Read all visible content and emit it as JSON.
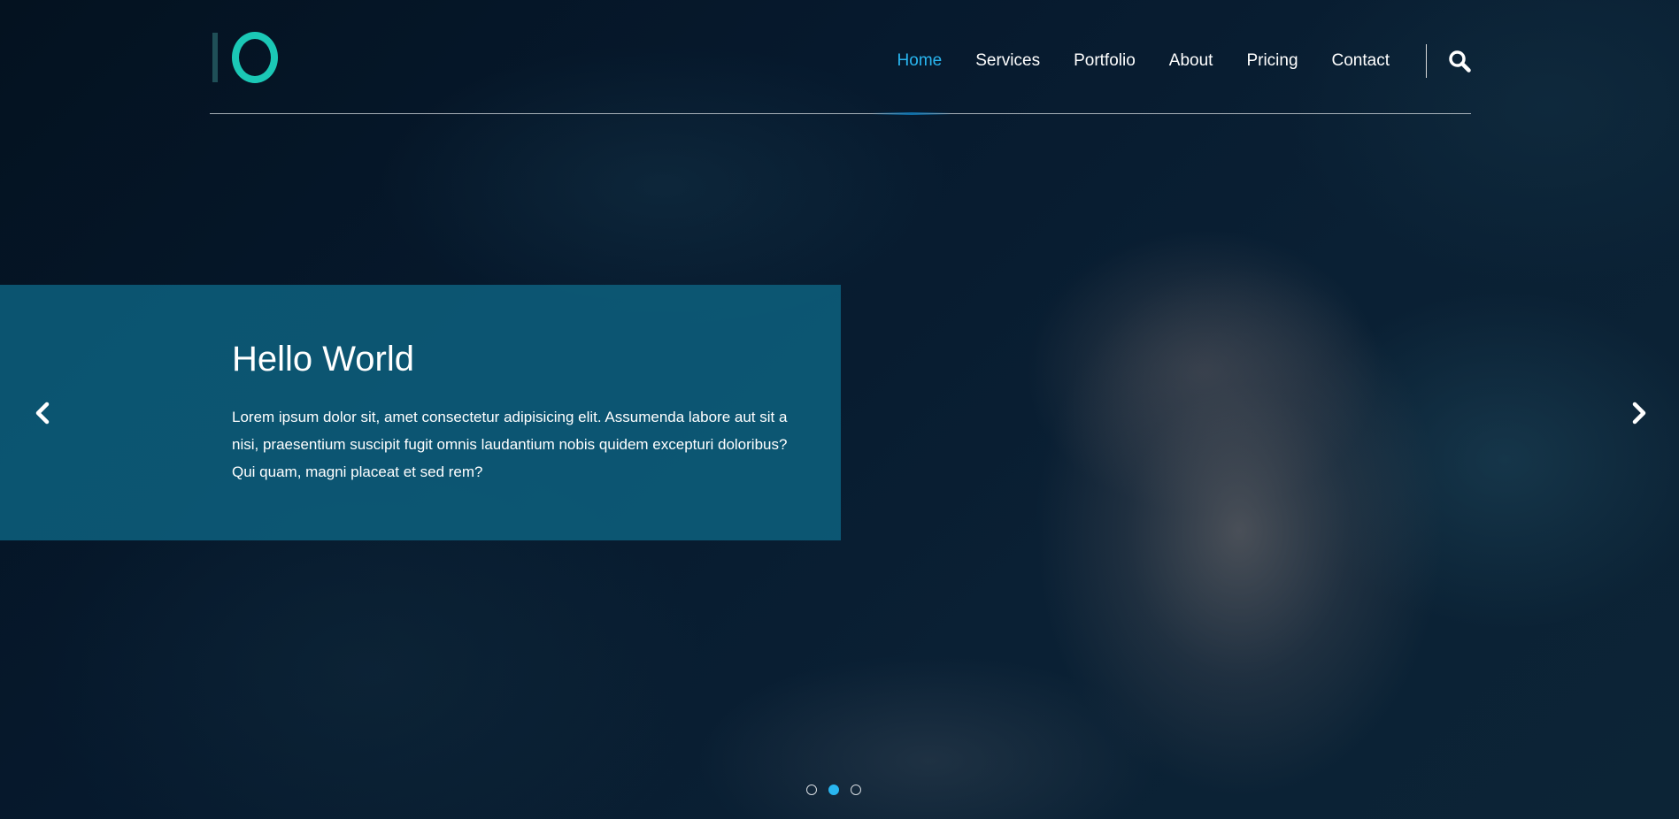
{
  "logo": {
    "alt": "IO",
    "bar_color": "#1f4f57",
    "ring_color": "#1bc8b6"
  },
  "nav": {
    "items": [
      {
        "label": "Home",
        "active": true
      },
      {
        "label": "Services",
        "active": false
      },
      {
        "label": "Portfolio",
        "active": false
      },
      {
        "label": "About",
        "active": false
      },
      {
        "label": "Pricing",
        "active": false
      },
      {
        "label": "Contact",
        "active": false
      }
    ],
    "search_icon": "search-icon",
    "active_color": "#29b6f0"
  },
  "slide": {
    "title": "Hello World",
    "text": "Lorem ipsum dolor sit, amet consectetur adipisicing elit. Assumenda labore aut sit a nisi, praesentium suscipit fugit omnis laudantium nobis quidem excepturi doloribus? Qui quam, magni placeat et sed rem?",
    "panel_color": "#0d6381"
  },
  "carousel": {
    "prev_icon": "chevron-left-icon",
    "next_icon": "chevron-right-icon",
    "slide_count": 3,
    "active_index": 1
  }
}
